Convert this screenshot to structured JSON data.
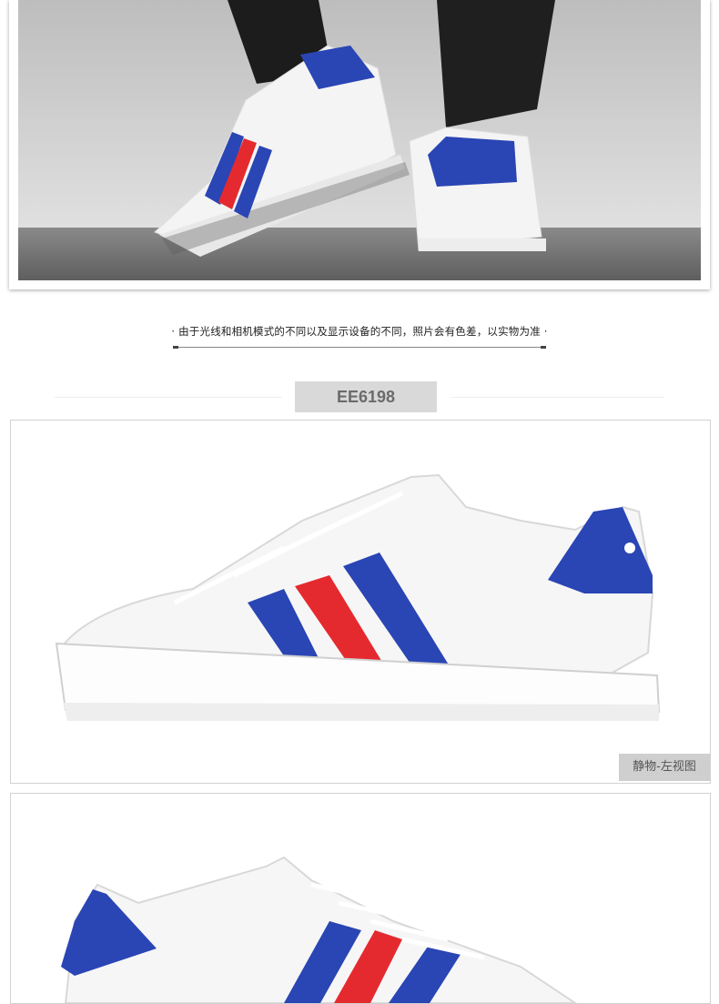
{
  "disclaimer": "· 由于光线和相机模式的不同以及显示设备的不同，照片会有色差，以实物为准 ·",
  "model_code": "EE6198",
  "views": [
    {
      "tag": "静物-左视图"
    }
  ],
  "colors": {
    "stripe_blue": "#2a45b4",
    "stripe_red": "#e52a2f",
    "sole_white": "#f5f5f5",
    "floor_gray": "#6e6e6e",
    "wall_gray": "#d4d4d4"
  },
  "icons": [
    "trefoil-logo-icon"
  ]
}
